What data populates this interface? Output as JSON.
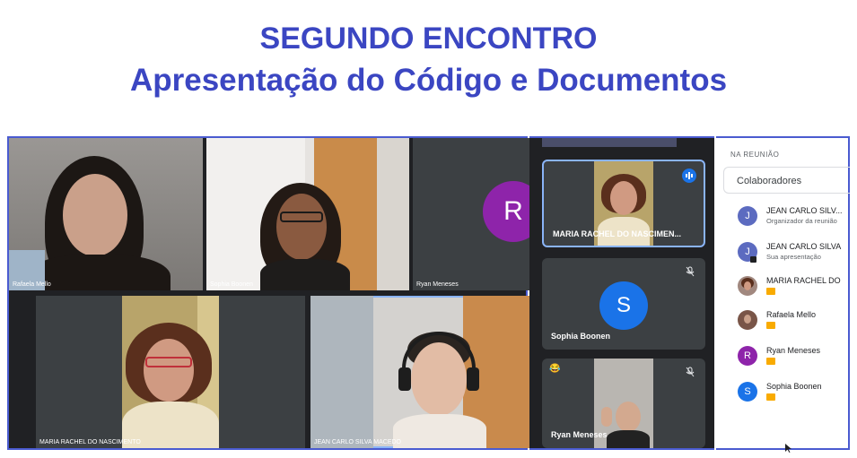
{
  "slide": {
    "title_line1": "SEGUNDO ENCONTRO",
    "title_line2": "Apresentação do Código e Documentos"
  },
  "grid_tiles": [
    {
      "name": "Rafaela Mello"
    },
    {
      "name": "Sophia Boonen"
    },
    {
      "name": "Ryan Meneses",
      "avatar_letter": "R",
      "avatar_color": "#8e24aa"
    },
    {
      "name": "MARIA RACHEL DO NASCIMENTO"
    },
    {
      "name": "JEAN CARLO SILVA MACEDO"
    }
  ],
  "side_strip": {
    "tiles": [
      {
        "name": "MARIA RACHEL DO NASCIMEN..."
      },
      {
        "name": "Sophia Boonen",
        "avatar_letter": "S",
        "avatar_color": "#1a73e8"
      },
      {
        "name": "Ryan Meneses",
        "reaction": "😂"
      }
    ]
  },
  "people_panel": {
    "section_label": "NA REUNIÃO",
    "group_label": "Colaboradores",
    "participants": [
      {
        "name": "JEAN CARLO SILV...",
        "subtitle": "Organizador da reunião",
        "avatar_letter": "J",
        "avatar_color": "#5c6bc0"
      },
      {
        "name": "JEAN CARLO SILVA",
        "subtitle": "Sua apresentação",
        "avatar_letter": "J",
        "avatar_color": "#5c6bc0"
      },
      {
        "name": "MARIA RACHEL DO",
        "avatar_letter": "",
        "avatar_color": "#a1887f"
      },
      {
        "name": "Rafaela Mello",
        "avatar_letter": "",
        "avatar_color": "#795548"
      },
      {
        "name": "Ryan Meneses",
        "avatar_letter": "R",
        "avatar_color": "#8e24aa"
      },
      {
        "name": "Sophia Boonen",
        "avatar_letter": "S",
        "avatar_color": "#1a73e8"
      }
    ]
  },
  "icons": [
    "mic-off-icon",
    "audio-level-icon",
    "hand-raised-badge-icon",
    "cursor-icon"
  ]
}
